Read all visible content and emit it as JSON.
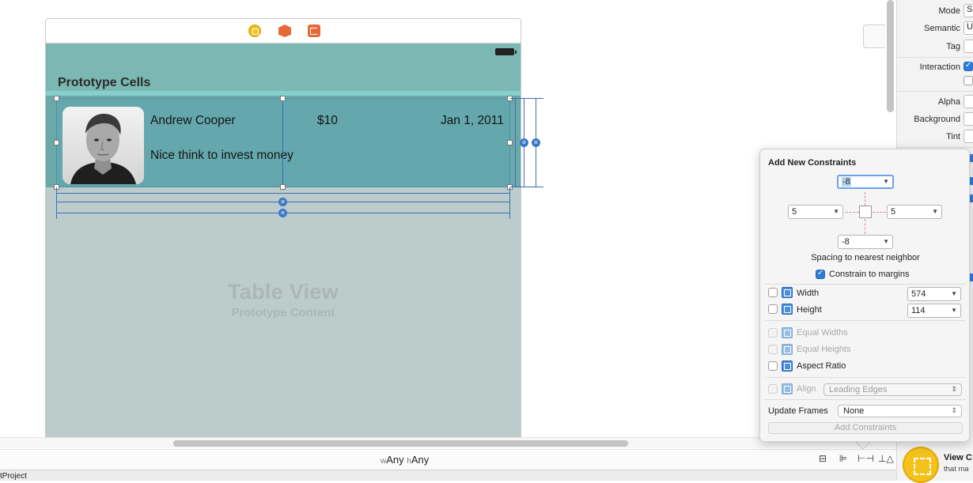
{
  "scene": {
    "section_header": "Prototype Cells",
    "watermark_title": "Table View",
    "watermark_subtitle": "Prototype Content",
    "icons": [
      "view-controller-icon",
      "first-responder-icon",
      "exit-icon"
    ]
  },
  "cell": {
    "name": "Andrew Cooper",
    "price": "$10",
    "date": "Jan 1, 2011",
    "description": "Nice think to invest money"
  },
  "inspector": {
    "mode_label": "Mode",
    "mode_value": "S",
    "semantic_label": "Semantic",
    "semantic_value": "U",
    "tag_label": "Tag",
    "interaction_label": "Interaction",
    "interaction_checked": true,
    "alpha_label": "Alpha",
    "background_label": "Background",
    "tint_label": "Tint"
  },
  "bottom_bar": {
    "w_prefix": "w",
    "w_value": "Any",
    "h_prefix": "h",
    "h_value": "Any",
    "project_name": "tProject",
    "icons": [
      "stack-icon",
      "align-icon",
      "pin-icon",
      "resolve-issues-icon"
    ]
  },
  "library": {
    "vc_title": "View C",
    "vc_desc": "that ma"
  },
  "constraints_popover": {
    "title": "Add New Constraints",
    "top_value": "-8",
    "left_value": "5",
    "right_value": "5",
    "bottom_value": "-8",
    "spacing_caption": "Spacing to nearest neighbor",
    "constrain_margins_label": "Constrain to margins",
    "constrain_margins_checked": true,
    "width_label": "Width",
    "width_value": "574",
    "height_label": "Height",
    "height_value": "114",
    "equal_widths_label": "Equal Widths",
    "equal_heights_label": "Equal Heights",
    "aspect_ratio_label": "Aspect Ratio",
    "align_label": "Align",
    "align_value": "Leading Edges",
    "update_frames_label": "Update Frames",
    "update_frames_value": "None",
    "add_button_label": "Add Constraints"
  },
  "colors": {
    "nav_bar": "#7cb8b3",
    "cell_background": "#64a7ad",
    "table_background": "#bccccb",
    "accent_blue": "#2e7bd8"
  }
}
